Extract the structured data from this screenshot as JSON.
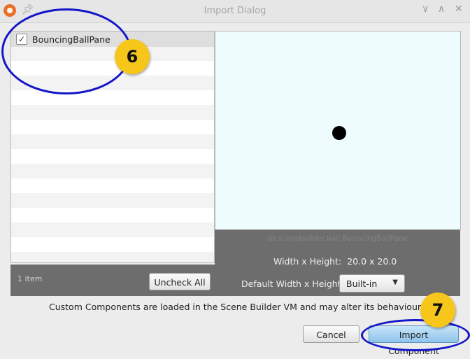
{
  "window": {
    "title": "Import Dialog",
    "controls": {
      "minimize": "∨",
      "maximize": "∧",
      "close": "✕"
    }
  },
  "list": {
    "items": [
      {
        "label": "BouncingBallPane",
        "checked": true
      }
    ],
    "count_label": "1 item",
    "uncheck_all_label": "Uncheck All"
  },
  "preview": {
    "class_name": "sb.scenebuilder.ball.BouncingBallPane",
    "size_label": "Width x Height:",
    "size_value": "20.0 x 20.0",
    "default_size_label": "Default Width x Height:",
    "default_size_selected": "Built-in"
  },
  "footer": {
    "notice": "Custom Components are loaded in the Scene Builder VM and may alter its behaviour",
    "cancel_label": "Cancel",
    "import_label": "Import Component"
  },
  "annotations": {
    "marker_6": "6",
    "marker_7": "7"
  },
  "colors": {
    "annotation_ring": "#1416c8",
    "badge_fill": "#f6c71a",
    "preview_background": "#effcfd",
    "info_panel": "#6d6d6d",
    "default_button": "#a8d3f2"
  }
}
